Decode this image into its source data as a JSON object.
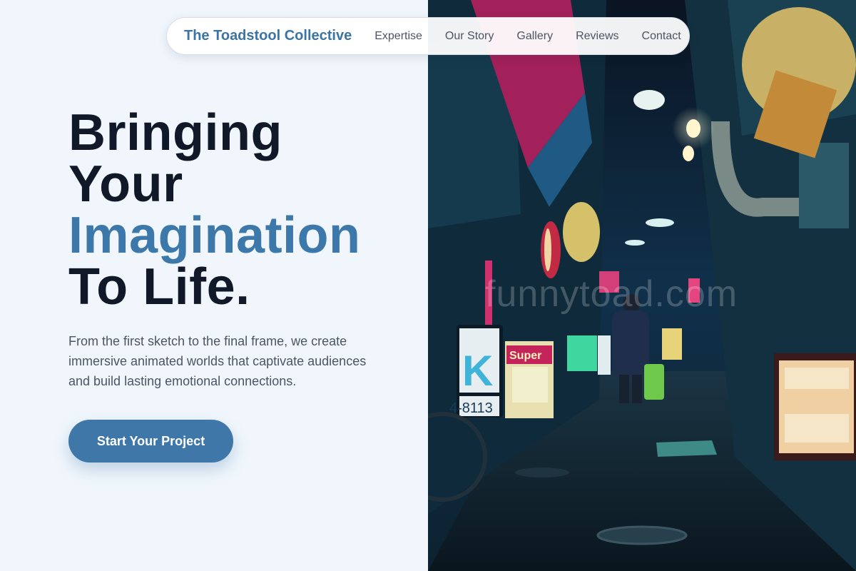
{
  "nav": {
    "brand": "The Toadstool Collective",
    "links": [
      "Expertise",
      "Our Story",
      "Gallery",
      "Reviews",
      "Contact"
    ]
  },
  "hero": {
    "title_line1": "Bringing",
    "title_line2": "Your",
    "title_accent": "Imagination",
    "title_line4": "To Life.",
    "description": "From the first sketch to the final frame, we create immersive animated worlds that captivate audiences and build lasting emotional connections.",
    "cta_label": "Start Your Project"
  },
  "image": {
    "watermark": "funnytoad.com",
    "sign_super": "Super",
    "sign_letter": "K",
    "sign_number": "4-8113"
  },
  "colors": {
    "accent": "#3d78aa",
    "background": "#f0f6fc",
    "heading": "#111827"
  }
}
